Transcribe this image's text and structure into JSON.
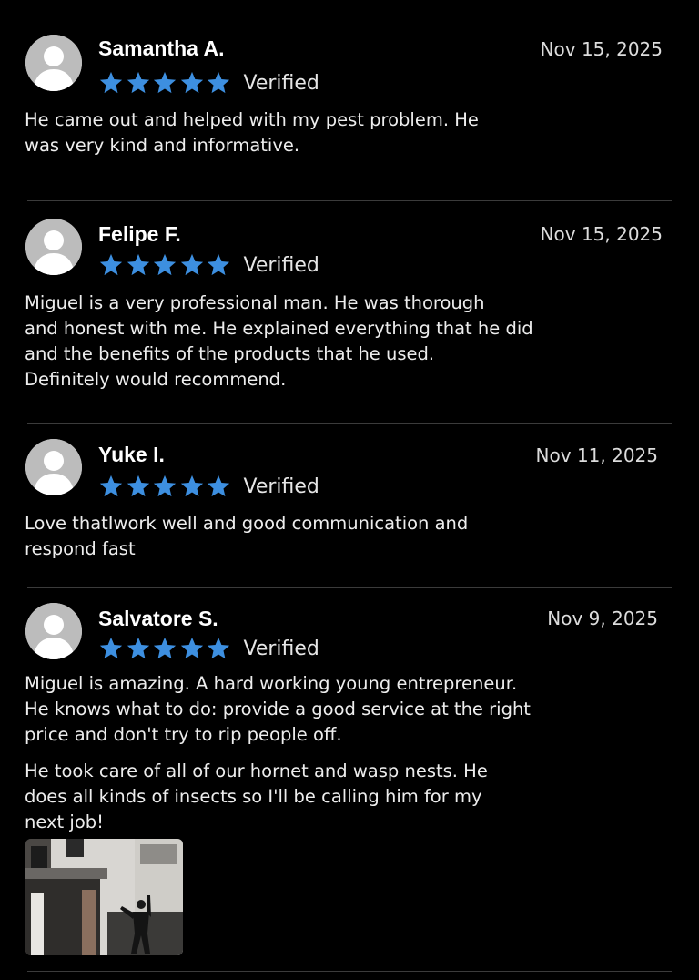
{
  "reviews": [
    {
      "name": "Samantha A.",
      "date": "Nov 15, 2025",
      "rating": 5,
      "verified_label": "Verified",
      "paragraphs": [
        "He came out and helped with my pest problem. He\nwas very kind and informative."
      ]
    },
    {
      "name": "Felipe F.",
      "date": "Nov 15, 2025",
      "rating": 5,
      "verified_label": "Verified",
      "paragraphs": [
        "Miguel is a very professional man. He was thorough\nand honest with me. He explained everything that he did\nand the benefits of the products that he used.\nDefinitely would recommend."
      ]
    },
    {
      "name": "Yuke I.",
      "date": "Nov 11, 2025",
      "rating": 5,
      "verified_label": "Verified",
      "paragraphs": [
        "Love thatIwork well and good communication and\nrespond fast"
      ]
    },
    {
      "name": "Salvatore S.",
      "date": "Nov 9, 2025",
      "rating": 5,
      "verified_label": "Verified",
      "paragraphs": [
        "Miguel is amazing. A hard working young entrepreneur.\nHe knows what to do: provide a good service at the right\nprice and don't try to rip people off.",
        "He took care of all of our hornet and wasp nests. He\ndoes all kinds of insects so I'll be calling him for my\nnext job!"
      ],
      "has_photo": true
    }
  ],
  "icons": {
    "avatar": "default-avatar-icon",
    "star": "star-icon"
  },
  "colors": {
    "background": "#000000",
    "star": "#3d8fe0",
    "divider": "#3b3b3b",
    "text": "#ededed"
  }
}
